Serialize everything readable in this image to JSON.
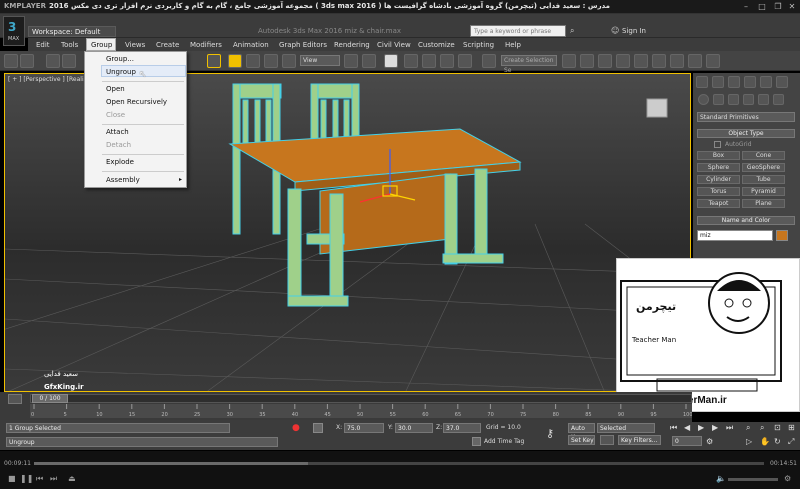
{
  "player": {
    "logo": "KMPLAYER",
    "title": "مجموعه آموزشی جامع ، گام به گام و کاربردی نرم افزار تری دی مکس 2016 ( 3ds max 2016 ) مدرس : سعید فدایی (تیچرمن) گروه آموزشی بادشاه گرافیست ها",
    "time_current": "00:09:11",
    "time_total": "00:14:51"
  },
  "max": {
    "logo": "MAX",
    "workspace": "Workspace: Default",
    "doc_title": "Autodesk 3ds Max 2016    miz & chair.max",
    "search_placeholder": "Type a keyword or phrase",
    "signin": "Sign In"
  },
  "menu": [
    "Edit",
    "Tools",
    "Group",
    "Views",
    "Create",
    "Modifiers",
    "Animation",
    "Graph Editors",
    "Rendering",
    "Civil View",
    "Customize",
    "Scripting",
    "Help"
  ],
  "group_menu": {
    "items": [
      "Group...",
      "Ungroup",
      "Open",
      "Open Recursively",
      "Close",
      "Attach",
      "Detach",
      "Explode",
      "Assembly"
    ],
    "disabled": [
      4,
      6
    ],
    "highlight": 1
  },
  "toolbar": {
    "view": "View",
    "selection_set": "Create Selection Se"
  },
  "viewport": {
    "label": "[ + ] [Perspective ] [Realistic ]"
  },
  "command_panel": {
    "dropdown": "Standard Primitives",
    "object_type": "Object Type",
    "autogrid": "AutoGrid",
    "primitives": [
      "Box",
      "Cone",
      "Sphere",
      "GeoSphere",
      "Cylinder",
      "Tube",
      "Torus",
      "Pyramid",
      "Teapot",
      "Plane"
    ],
    "name_color": "Name and Color",
    "name": "miz"
  },
  "timeline": {
    "frames": "0 / 100",
    "ticks": [
      "0",
      "5",
      "10",
      "15",
      "20",
      "25",
      "30",
      "35",
      "40",
      "45",
      "50",
      "55",
      "60",
      "65",
      "70",
      "75",
      "80",
      "85",
      "90",
      "95",
      "100"
    ]
  },
  "status": {
    "selected": "1 Group Selected",
    "prompt": "Ungroup",
    "x": "75.0",
    "y": "30.0",
    "z": "37.0",
    "grid": "Grid = 10.0",
    "auto_key": "Auto Key",
    "selected_dd": "Selected",
    "set_key": "Set Key",
    "key_filters": "Key Filters...",
    "add_time_tag": "Add Time Tag",
    "frame": "0"
  },
  "watermark": {
    "url": "www.TeacherMan.ir",
    "brand": "Teacher Man",
    "gfx": "GfxKing.ir",
    "logo": "تیچرمن",
    "sig": "سعید فدایی"
  },
  "colors": {
    "table": "#c7761e",
    "chair": "#9fd08a",
    "selection": "#44d0e8"
  }
}
